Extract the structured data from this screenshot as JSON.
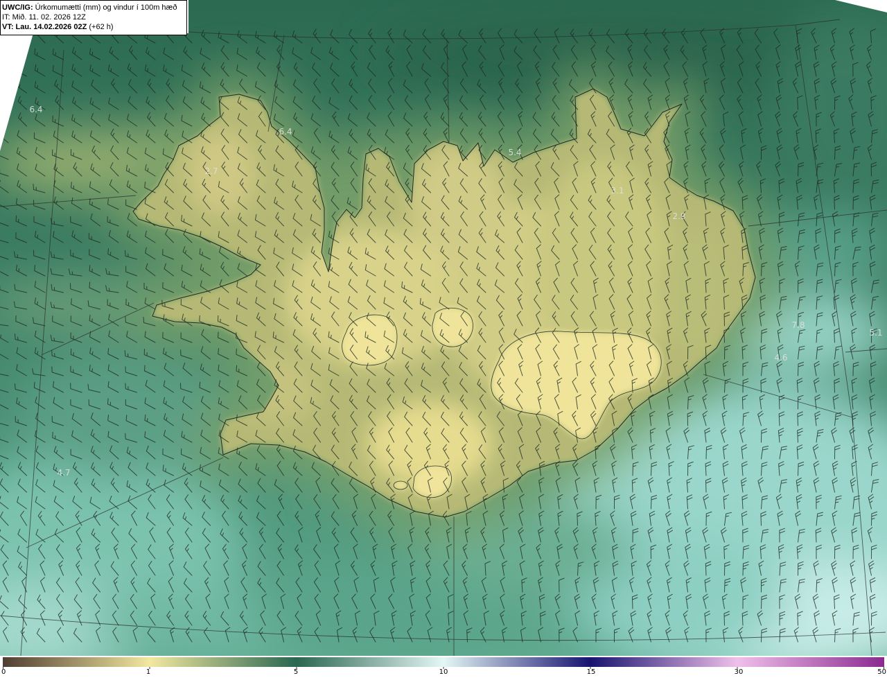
{
  "header": {
    "product": "UWC/IG:",
    "title": "Úrkomumætti (mm) og vindur í 100m hæð",
    "issue_time": "IT: Mið. 11. 02. 2026 12Z",
    "valid_time": "VT: Lau. 14.02.2026 02Z",
    "lead": "(+62 h)"
  },
  "map_labels": [
    "6.4",
    "6.4",
    "2.7",
    "5.4",
    "3.1",
    "2.9",
    "7.8",
    "5.1",
    "4.6",
    "4.7"
  ],
  "colorbar": {
    "ticks": [
      "0",
      "1",
      "5",
      "10",
      "15",
      "30",
      "50"
    ],
    "tick_colors": [
      "#4f3e31",
      "#f2e8a0",
      "#2a6650",
      "#e4f7f5",
      "#17136f",
      "#f0c0ea",
      "#8a2a90"
    ]
  }
}
